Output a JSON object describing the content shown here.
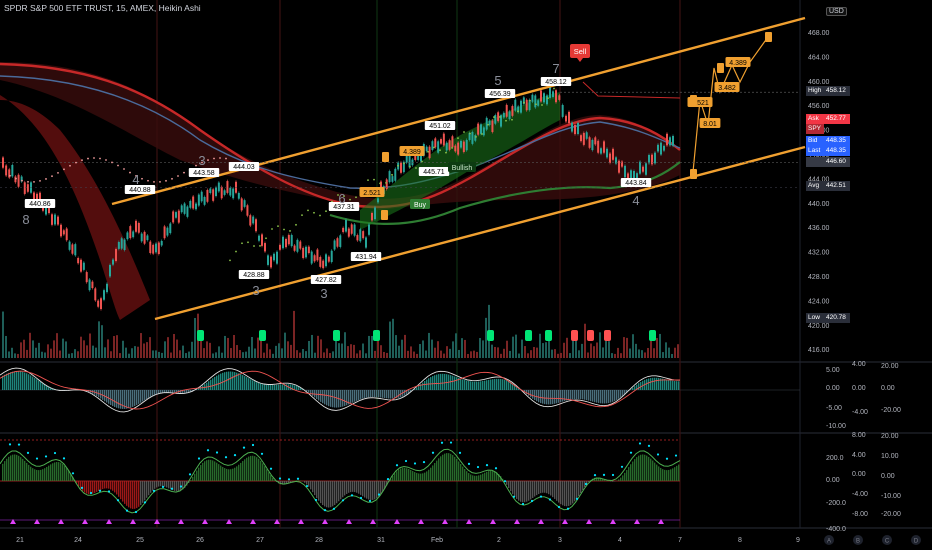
{
  "header": {
    "title": "SPDR S&P 500 ETF TRUST, 15, AMEX, Heikin Ashi",
    "currency": "USD"
  },
  "price_axis": {
    "ticks": [
      "468.00",
      "464.00",
      "460.00",
      "456.00",
      "452.00",
      "448.00",
      "444.00",
      "440.00",
      "436.00",
      "432.00",
      "428.00",
      "424.00",
      "420.00",
      "416.00"
    ]
  },
  "price_tags": {
    "high_label": "High",
    "high_value": "458.12",
    "ask_label": "Ask",
    "ask_value": "452.77",
    "symbol": "SPY",
    "bid_label": "Bid",
    "bid_value": "448.35",
    "last_label": "Last",
    "last_value": "448.35",
    "close_value": "446.60",
    "avg_label": "Avg",
    "avg_value": "442.51",
    "low_label": "Low",
    "low_value": "420.78",
    "colors": {
      "high": "#2a2e39",
      "ask": "#f23645",
      "symbol": "#b22833",
      "bid": "#2962ff",
      "last": "#2962ff",
      "close": "#363a45",
      "avg": "#2a2e39",
      "low": "#2a2e39"
    }
  },
  "annotations": {
    "price_labels": [
      "440.86",
      "440.88",
      "443.58",
      "444.03",
      "428.88",
      "437.31",
      "427.82",
      "431.94",
      "451.02",
      "445.71",
      "456.39",
      "458.12",
      "443.84"
    ],
    "wave_labels": [
      "8",
      "4",
      "3",
      "3",
      "3",
      "6",
      "5",
      "7",
      "4"
    ],
    "projection_labels": [
      "2.521",
      "4.389",
      "2.521",
      "3.482",
      "8.01",
      "4.389"
    ],
    "sell_label": "Sell",
    "buy_label": "Buy",
    "bullish_label": "Bullish"
  },
  "osc1_axis": {
    "inner": [
      "5.00",
      "0.00",
      "-5.00",
      "-10.00"
    ],
    "mid": [
      "4.00",
      "0.00",
      "-4.00"
    ],
    "outer": [
      "20.00",
      "0.00",
      "-20.00"
    ]
  },
  "osc2_axis": {
    "inner": [
      "200.0",
      "0.00",
      "-200.0",
      "-400.0"
    ],
    "mid": [
      "8.00",
      "4.00",
      "0.00",
      "-4.00",
      "-8.00"
    ],
    "outer": [
      "20.00",
      "10.00",
      "0.00",
      "-10.00",
      "-20.00"
    ]
  },
  "time_axis": {
    "labels": [
      "21",
      "24",
      "25",
      "26",
      "27",
      "28",
      "31",
      "Feb",
      "2",
      "3",
      "4",
      "7",
      "8",
      "9"
    ],
    "letters": [
      "A",
      "B",
      "C",
      "D"
    ]
  }
}
